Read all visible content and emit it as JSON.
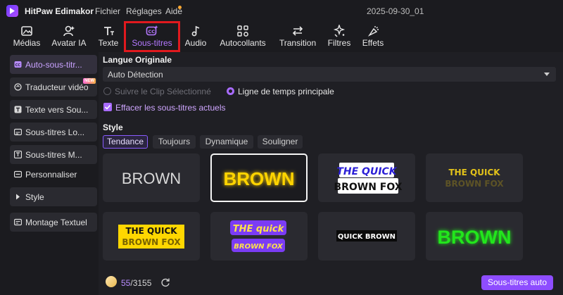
{
  "app": {
    "name": "HitPaw Edimakor",
    "project_name": "2025-09-30_01",
    "menu": [
      "Fichier",
      "Réglages",
      "Aide"
    ]
  },
  "toolbar": {
    "tabs": [
      {
        "label": "Médias",
        "icon": "media-icon"
      },
      {
        "label": "Avatar IA",
        "icon": "avatar-icon"
      },
      {
        "label": "Texte",
        "icon": "text-icon"
      },
      {
        "label": "Sous-titres",
        "icon": "subtitles-icon",
        "active": true
      },
      {
        "label": "Audio",
        "icon": "audio-icon"
      },
      {
        "label": "Autocollants",
        "icon": "stickers-icon"
      },
      {
        "label": "Transition",
        "icon": "transition-icon"
      },
      {
        "label": "Filtres",
        "icon": "filters-icon"
      },
      {
        "label": "Effets",
        "icon": "effects-icon"
      }
    ]
  },
  "sidebar": {
    "items": [
      {
        "label": "Auto-sous-titr...",
        "icon": "cc-icon",
        "active": true
      },
      {
        "label": "Traducteur vidéo",
        "icon": "translate-icon",
        "badge": "NEW"
      },
      {
        "label": "Texte vers Sou...",
        "icon": "text-to-sub-icon"
      },
      {
        "label": "Sous-titres Lo...",
        "icon": "local-sub-icon"
      },
      {
        "label": "Sous-titres M...",
        "icon": "manual-sub-icon"
      },
      {
        "label": "Personnaliser",
        "icon": "customize-icon"
      },
      {
        "label": "Style",
        "icon": "caret-right-icon"
      },
      {
        "label": "Montage Textuel",
        "icon": "text-edit-icon"
      }
    ]
  },
  "main": {
    "language_title": "Langue Originale",
    "language_value": "Auto Détection",
    "radio_follow_clip": "Suivre le Clip Sélectionné",
    "radio_main_timeline": "Ligne de temps principale",
    "checkbox_clear": "Effacer les sous-titres actuels",
    "style_title": "Style",
    "style_tabs": [
      "Tendance",
      "Toujours",
      "Dynamique",
      "Souligner"
    ],
    "presets": [
      {
        "text": "BROWN"
      },
      {
        "text": "BROWN"
      },
      {
        "line1": "THE QUICK",
        "line2": "BROWN FOX"
      },
      {
        "line1": "THE QUICK",
        "line2": "BROWN FOX"
      },
      {
        "line1": "THE QUICK",
        "line2": "BROWN FOX"
      },
      {
        "line1": "THE quick",
        "line2": "BROWN FOX"
      },
      {
        "text": "QUICK BROWN"
      },
      {
        "text": "BROWN"
      }
    ]
  },
  "footer": {
    "credits_used": "55",
    "credits_total": "/3155",
    "auto_button": "Sous-titres auto"
  },
  "colors": {
    "accent": "#8e4dff",
    "highlight_outline": "#e0191e",
    "background": "#1b1b1f"
  }
}
